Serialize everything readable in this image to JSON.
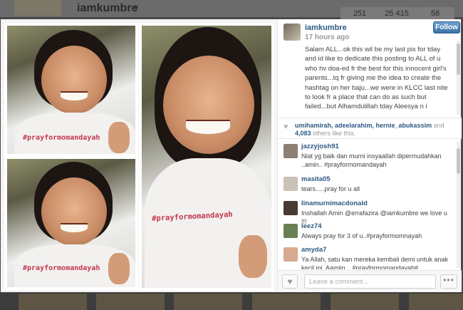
{
  "background": {
    "username": "iamkumbre",
    "stats": [
      "251",
      "25 415",
      "58"
    ]
  },
  "post": {
    "owner": "iamkumbre",
    "time": "17 hours ago",
    "follow_label": "Follow",
    "caption": "Salam ALL...ok this wil be my last pix for tday and id like to dedicate this posting to ALL of u who hv doa-ed fr the best for this innocent girl's parents...tq fr giving me the idea to create the hashtag on her baju...we were in KLCC last nite to look fr a place that can do as such but failed...but Alhamdulillah tday Aleesya n i managed to find a shop that wud do it...last nite Aleesya n i had an intimate chat",
    "shirt_text": "#prayformomandayah",
    "likes": {
      "names": "umihamirah, adeelarahim, hernie_abukassim",
      "and": " and ",
      "count": "4,083",
      "suffix": " others like this."
    }
  },
  "comments": [
    {
      "user": "jazzyjosh91",
      "text": "Niat yg baik dan murni insyaallah dipermudahkan ..amin.. #prayformomandayah",
      "avatar_color": "#8d7f74"
    },
    {
      "user": "masita05",
      "text": "tears.....pray for u all",
      "avatar_color": "#c9c2b6"
    },
    {
      "user": "linamurnimacdonald",
      "text": "Inshallah Amin @errafazira @iamkumbre we love u !!!",
      "avatar_color": "#4a3a34"
    },
    {
      "user": "leez74",
      "text": "Always pray for 3 of u..#prayformomnayah",
      "avatar_color": "#6b7f55"
    },
    {
      "user": "amyda7",
      "text": "Ya Allah, satu kan mereka kembali demi untuk anak kecil ini. Aamiin... #prayformomandayah# @iamkumbre",
      "avatar_color": "#d7a98f"
    }
  ],
  "comment_input": {
    "placeholder": "Leave a comment..."
  },
  "icons": {
    "heart": "heart-icon",
    "more": "more-options-icon"
  },
  "colors": {
    "link": "#2b5a83",
    "follow_button": "#3b73a8"
  }
}
